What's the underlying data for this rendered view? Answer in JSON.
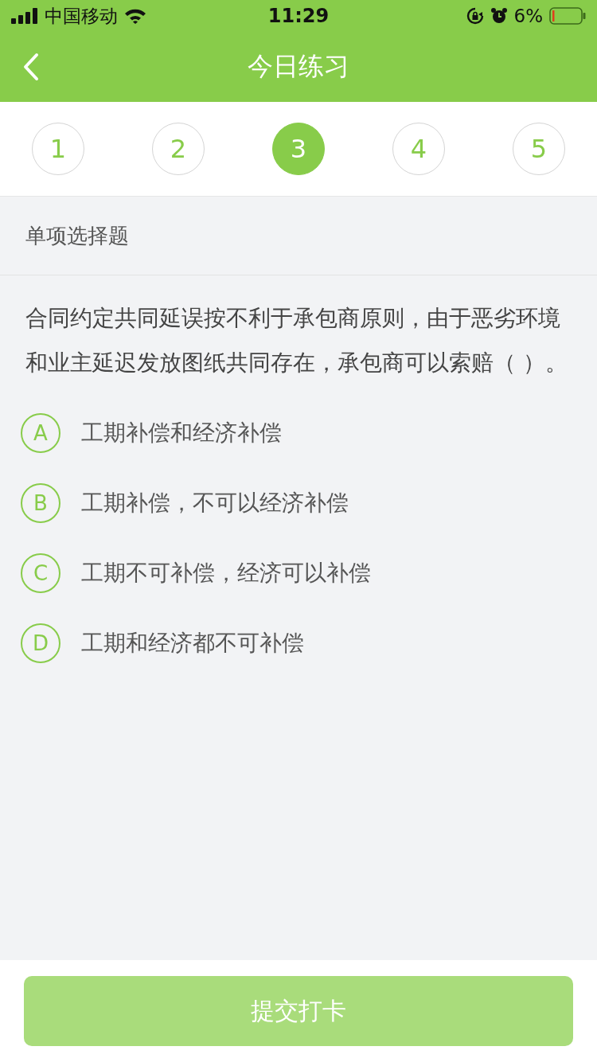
{
  "status_bar": {
    "carrier": "中国移动",
    "time": "11:29",
    "battery_percent": "6%"
  },
  "nav": {
    "title": "今日练习"
  },
  "question_tabs": [
    {
      "label": "1",
      "selected": false
    },
    {
      "label": "2",
      "selected": false
    },
    {
      "label": "3",
      "selected": true
    },
    {
      "label": "4",
      "selected": false
    },
    {
      "label": "5",
      "selected": false
    }
  ],
  "question_type": "单项选择题",
  "question": "合同约定共同延误按不利于承包商原则，由于恶劣环境和业主延迟发放图纸共同存在，承包商可以索赔（ ）。",
  "options": [
    {
      "letter": "A",
      "text": "工期补偿和经济补偿",
      "selected": false
    },
    {
      "letter": "B",
      "text": "工期补偿，不可以经济补偿",
      "selected": false
    },
    {
      "letter": "C",
      "text": "工期不可补偿，经济可以补偿",
      "selected": false
    },
    {
      "letter": "D",
      "text": "工期和经济都不可补偿",
      "selected": false
    }
  ],
  "submit": {
    "label": "提交打卡",
    "disabled": true
  }
}
